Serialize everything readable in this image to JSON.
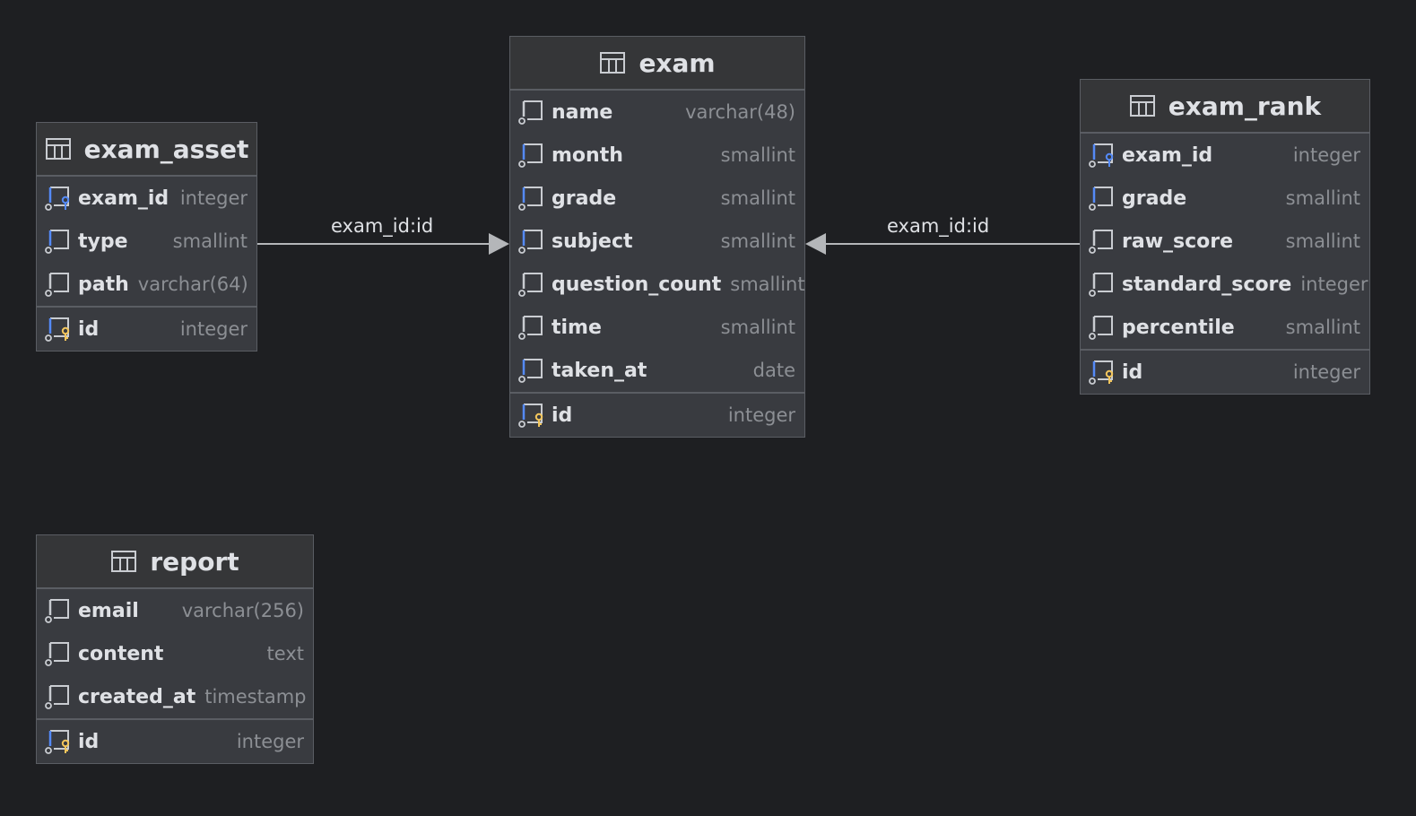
{
  "relations": [
    {
      "label": "exam_id:id"
    },
    {
      "label": "exam_id:id"
    }
  ],
  "tables": {
    "exam": {
      "title": "exam",
      "columns": [
        {
          "name": "name",
          "type": "varchar(48)",
          "icon": "column-icon"
        },
        {
          "name": "month",
          "type": "smallint",
          "icon": "column-indexed-icon"
        },
        {
          "name": "grade",
          "type": "smallint",
          "icon": "column-indexed-icon"
        },
        {
          "name": "subject",
          "type": "smallint",
          "icon": "column-indexed-icon"
        },
        {
          "name": "question_count",
          "type": "smallint",
          "icon": "column-icon"
        },
        {
          "name": "time",
          "type": "smallint",
          "icon": "column-icon"
        },
        {
          "name": "taken_at",
          "type": "date",
          "icon": "column-indexed-icon"
        }
      ],
      "pk": {
        "name": "id",
        "type": "integer",
        "icon": "primary-key-icon"
      }
    },
    "exam_asset": {
      "title": "exam_asset",
      "columns": [
        {
          "name": "exam_id",
          "type": "integer",
          "icon": "foreign-key-icon"
        },
        {
          "name": "type",
          "type": "smallint",
          "icon": "column-indexed-icon"
        },
        {
          "name": "path",
          "type": "varchar(64)",
          "icon": "column-icon"
        }
      ],
      "pk": {
        "name": "id",
        "type": "integer",
        "icon": "primary-key-icon"
      }
    },
    "exam_rank": {
      "title": "exam_rank",
      "columns": [
        {
          "name": "exam_id",
          "type": "integer",
          "icon": "foreign-key-icon"
        },
        {
          "name": "grade",
          "type": "smallint",
          "icon": "column-indexed-icon"
        },
        {
          "name": "raw_score",
          "type": "smallint",
          "icon": "column-icon"
        },
        {
          "name": "standard_score",
          "type": "integer",
          "icon": "column-icon"
        },
        {
          "name": "percentile",
          "type": "smallint",
          "icon": "column-icon"
        }
      ],
      "pk": {
        "name": "id",
        "type": "integer",
        "icon": "primary-key-icon"
      }
    },
    "report": {
      "title": "report",
      "columns": [
        {
          "name": "email",
          "type": "varchar(256)",
          "icon": "column-icon"
        },
        {
          "name": "content",
          "type": "text",
          "icon": "column-icon"
        },
        {
          "name": "created_at",
          "type": "timestamp",
          "icon": "column-icon"
        }
      ],
      "pk": {
        "name": "id",
        "type": "integer",
        "icon": "primary-key-icon"
      }
    }
  },
  "colors": {
    "background": "#1e1f22",
    "table_body": "#393b40",
    "table_header": "#353638",
    "border": "#5a5d63",
    "text": "#dfe1e5",
    "type_text": "#8c8f94",
    "index_accent": "#548af7",
    "key_accent": "#f2c55c",
    "edge": "#b4b6b9"
  }
}
